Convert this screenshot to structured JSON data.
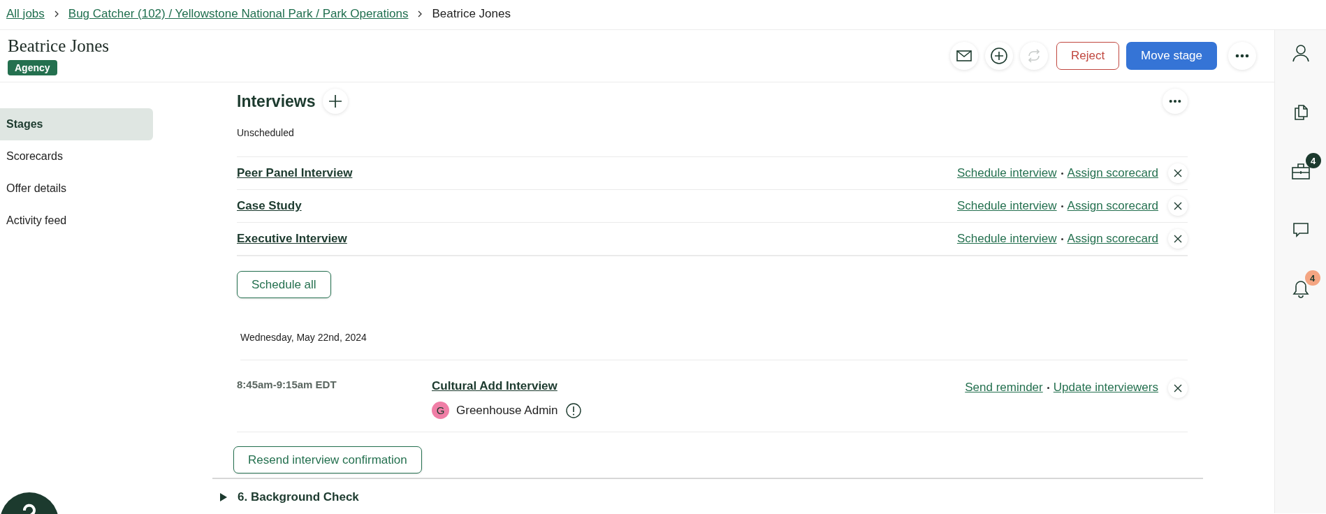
{
  "breadcrumb": {
    "links": [
      "All jobs",
      "Bug Catcher (102) / Yellowstone National Park / Park Operations"
    ],
    "current": "Beatrice Jones"
  },
  "candidate": {
    "name": "Beatrice Jones",
    "tag": "Agency"
  },
  "actions": {
    "refresh_disabled": true,
    "reject": "Reject",
    "move": "Move stage"
  },
  "nav": [
    {
      "label": "Stages",
      "selected": true
    },
    {
      "label": "Scorecards",
      "selected": false
    },
    {
      "label": "Offer details",
      "selected": false
    },
    {
      "label": "Activity feed",
      "selected": false
    }
  ],
  "interviews": {
    "title": "Interviews",
    "unscheduled_label": "Unscheduled",
    "unscheduled": [
      {
        "name": "Peer Panel Interview",
        "actions": [
          "Schedule interview",
          "Assign scorecard"
        ]
      },
      {
        "name": "Case Study",
        "actions": [
          "Schedule interview",
          "Assign scorecard"
        ]
      },
      {
        "name": "Executive Interview",
        "actions": [
          "Schedule interview",
          "Assign scorecard"
        ]
      }
    ],
    "schedule_all": "Schedule all",
    "date": "Wednesday, May 22nd, 2024",
    "scheduled": [
      {
        "time": "8:45am-9:15am EDT",
        "name": "Cultural Add Interview",
        "interviewer": {
          "initial": "G",
          "name": "Greenhouse Admin"
        },
        "actions": [
          "Send reminder",
          "Update interviewers"
        ]
      }
    ],
    "resend": "Resend interview confirmation"
  },
  "next_stage": {
    "title": "6. Background Check",
    "expanded": false
  },
  "rail": [
    {
      "kind": "person"
    },
    {
      "kind": "documents"
    },
    {
      "kind": "briefcase",
      "badge": "4",
      "color": "#1c3a2e"
    },
    {
      "kind": "chat"
    },
    {
      "kind": "bell",
      "badge": "4",
      "color": "#f4a582"
    }
  ]
}
